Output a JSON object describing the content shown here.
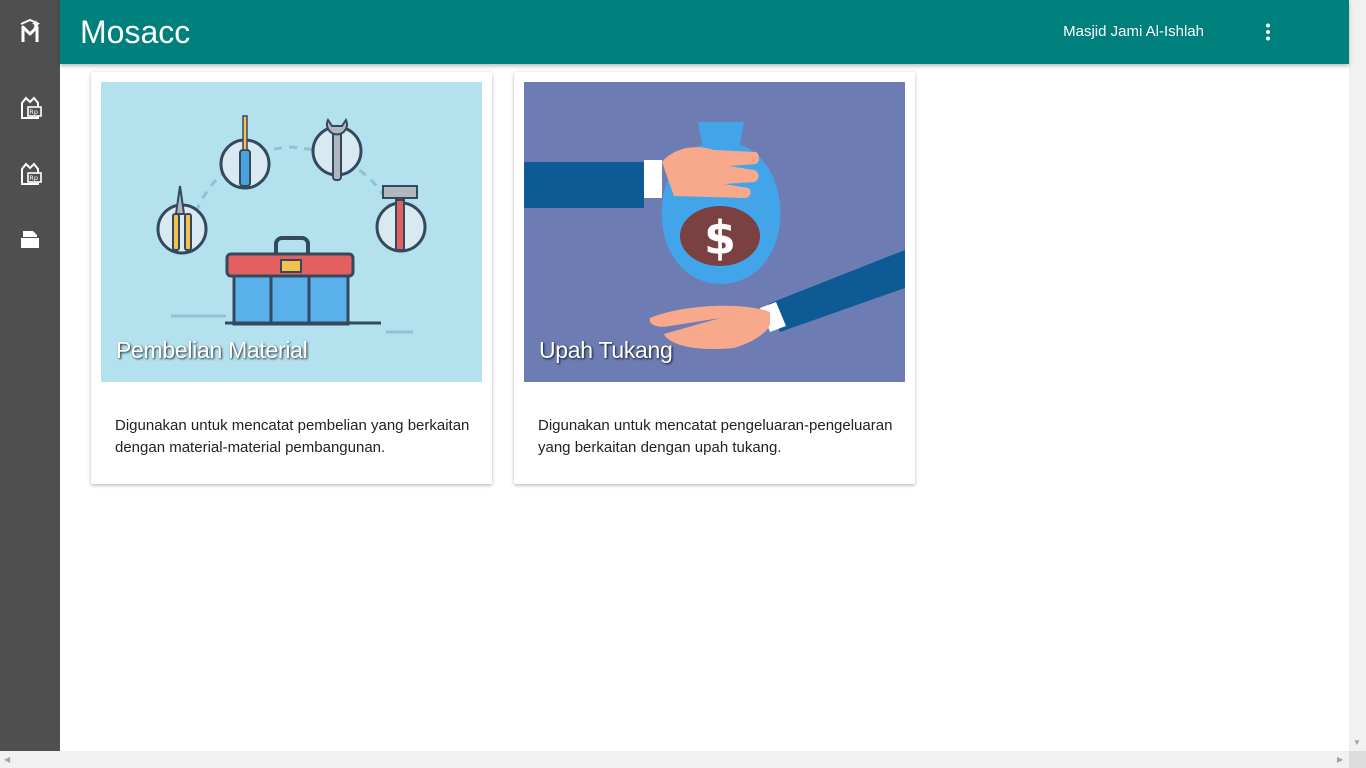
{
  "app": {
    "title": "Mosacc",
    "org_name": "Masjid Jami Al-Ishlah",
    "colors": {
      "appbar": "#00807d",
      "sidebar": "#4f4f4f"
    }
  },
  "sidebar": {
    "logo_icon": "mosacc-logo-icon",
    "items": [
      {
        "icon": "receipt-rp-icon"
      },
      {
        "icon": "receipt-rp-icon"
      },
      {
        "icon": "document-icon"
      }
    ]
  },
  "header": {
    "menu_icon": "more-vert-icon"
  },
  "cards": [
    {
      "title": "Pembelian Material",
      "description": "Digunakan untuk mencatat pembelian yang berkaitan dengan material-material pembangunan.",
      "image_icon": "toolbox-illustration",
      "media_color": "#b3e1ee"
    },
    {
      "title": "Upah Tukang",
      "description": "Digunakan untuk mencatat pengeluaran-pengeluaran yang berkaitan dengan upah tukang.",
      "image_icon": "money-bag-illustration",
      "media_color": "#6d7db4",
      "image_text": "$"
    }
  ],
  "scrollbars": {
    "left_arrow": "◀",
    "right_arrow": "▶",
    "down_arrow": "▼"
  }
}
